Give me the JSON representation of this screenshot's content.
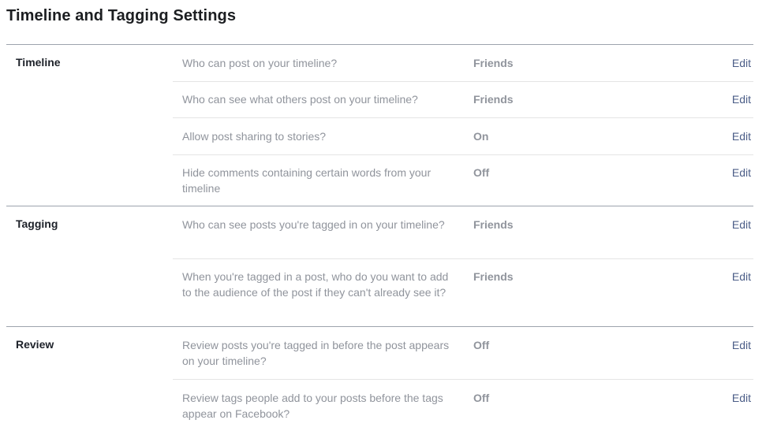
{
  "page": {
    "title": "Timeline and Tagging Settings"
  },
  "sections": [
    {
      "label": "Timeline",
      "rows": [
        {
          "question": "Who can post on your timeline?",
          "value": "Friends",
          "action": "Edit"
        },
        {
          "question": "Who can see what others post on your timeline?",
          "value": "Friends",
          "action": "Edit"
        },
        {
          "question": "Allow post sharing to stories?",
          "value": "On",
          "action": "Edit"
        },
        {
          "question": "Hide comments containing certain words from your timeline",
          "value": "Off",
          "action": "Edit"
        }
      ]
    },
    {
      "label": "Tagging",
      "rows": [
        {
          "question": "Who can see posts you're tagged in on your timeline?",
          "value": "Friends",
          "action": "Edit"
        },
        {
          "question": "When you're tagged in a post, who do you want to add to the audience of the post if they can't already see it?",
          "value": "Friends",
          "action": "Edit"
        }
      ]
    },
    {
      "label": "Review",
      "rows": [
        {
          "question": "Review posts you're tagged in before the post appears on your timeline?",
          "value": "Off",
          "action": "Edit"
        },
        {
          "question": "Review tags people add to your posts before the tags appear on Facebook?",
          "value": "Off",
          "action": "Edit"
        }
      ]
    }
  ],
  "colors": {
    "label": "#1d2129",
    "muted": "#90949c",
    "link": "#4b5d87",
    "section_border": "#9da3ad",
    "row_border": "#e5e5e5"
  }
}
